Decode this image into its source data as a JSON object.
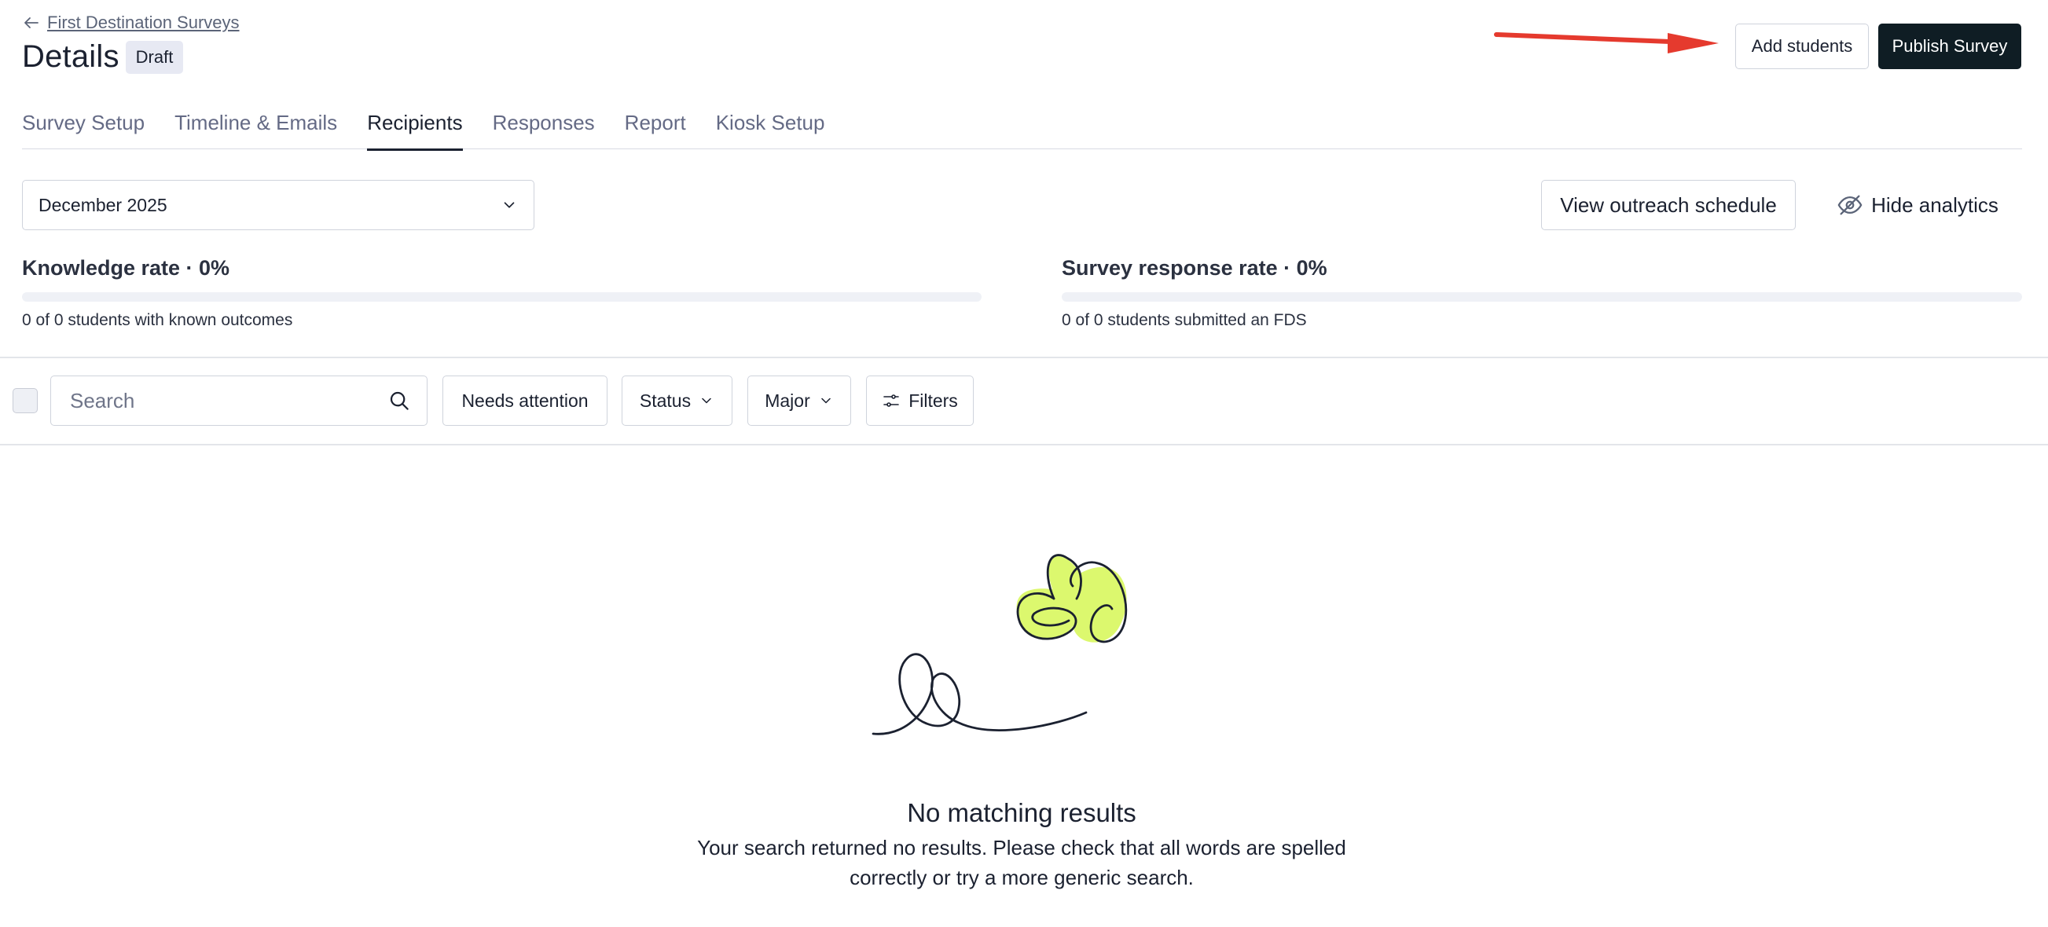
{
  "breadcrumb": {
    "back_icon": "arrow-left-icon",
    "link_label": "First Destination Surveys"
  },
  "header": {
    "title": "Details",
    "badge": "Draft"
  },
  "actions": {
    "add_students": "Add students",
    "publish": "Publish Survey"
  },
  "annotation": {
    "arrow_color": "#e53a2e"
  },
  "tabs": [
    {
      "label": "Survey Setup",
      "active": false
    },
    {
      "label": "Timeline & Emails",
      "active": false
    },
    {
      "label": "Recipients",
      "active": true
    },
    {
      "label": "Responses",
      "active": false
    },
    {
      "label": "Report",
      "active": false
    },
    {
      "label": "Kiosk Setup",
      "active": false
    }
  ],
  "period_select": {
    "value": "December 2025",
    "icon": "chevron-down-icon"
  },
  "analytics": {
    "view_outreach": "View outreach schedule",
    "hide_analytics": "Hide analytics",
    "hide_icon": "eye-slash-icon",
    "knowledge": {
      "label": "Knowledge rate · 0%",
      "sub": "0 of 0 students with known outcomes",
      "progress": 0
    },
    "response": {
      "label": "Survey response rate · 0%",
      "sub": "0 of 0 students submitted an FDS",
      "progress": 0
    }
  },
  "toolbar": {
    "search_placeholder": "Search",
    "needs_attention": "Needs attention",
    "status": "Status",
    "major": "Major",
    "filters": "Filters"
  },
  "empty_state": {
    "title": "No matching results",
    "line1": "Your search returned no results. Please check that all words are spelled",
    "line2": "correctly or try a more generic search.",
    "accent_color": "#dcf86e"
  }
}
